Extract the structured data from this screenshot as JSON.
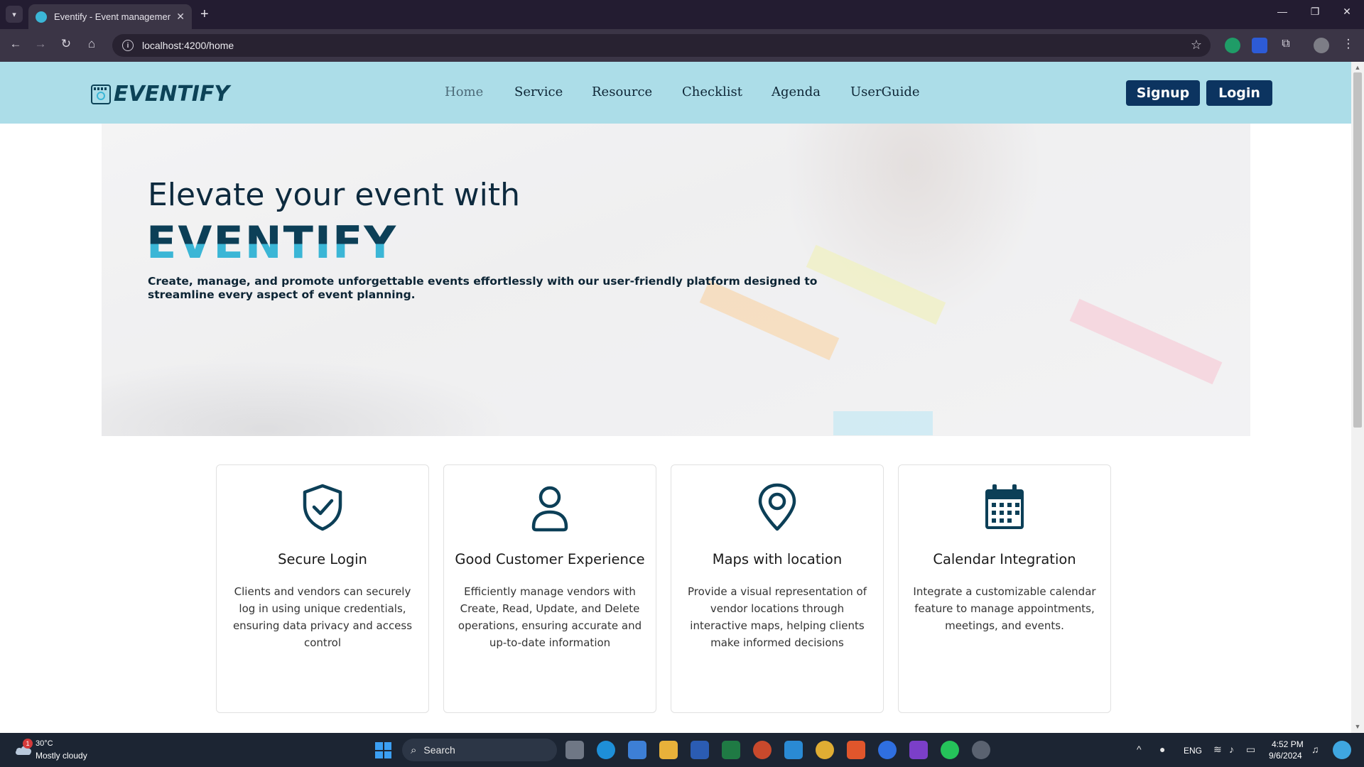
{
  "browser": {
    "tab_title": "Eventify - Event management s",
    "url": "localhost:4200/home"
  },
  "site": {
    "logo_text": "EVENTIFY",
    "nav": [
      {
        "label": "Home"
      },
      {
        "label": "Service"
      },
      {
        "label": "Resource"
      },
      {
        "label": "Checklist"
      },
      {
        "label": "Agenda"
      },
      {
        "label": "UserGuide"
      }
    ],
    "signup_label": "Signup",
    "login_label": "Login"
  },
  "hero": {
    "heading": "Elevate your event with",
    "brand": "EVENTIFY",
    "subtitle": "Create, manage, and promote unforgettable events effortlessly with our user-friendly platform designed to streamline every aspect of event planning."
  },
  "features": [
    {
      "icon": "shield-check-icon",
      "title": "Secure Login",
      "desc": "Clients and vendors can securely log in using unique credentials, ensuring data privacy and access control"
    },
    {
      "icon": "user-icon",
      "title": "Good Customer Experience",
      "desc": "Efficiently manage vendors with Create, Read, Update, and Delete operations, ensuring accurate and up-to-date information"
    },
    {
      "icon": "map-pin-icon",
      "title": "Maps with location",
      "desc": "Provide a visual representation of vendor locations through interactive maps, helping clients make informed decisions"
    },
    {
      "icon": "calendar-icon",
      "title": "Calendar Integration",
      "desc": "Integrate a customizable calendar feature to manage appointments, meetings, and events."
    }
  ],
  "taskbar": {
    "weather_temp": "30°C",
    "weather_desc": "Mostly cloudy",
    "weather_badge": "1",
    "search_label": "Search",
    "lang": "ENG",
    "time": "4:52 PM",
    "date": "9/6/2024"
  },
  "colors": {
    "nav_bg": "#acdde8",
    "brand_dark": "#0c4257",
    "brand_light": "#3bb6d6",
    "button_bg": "#0c3460"
  }
}
